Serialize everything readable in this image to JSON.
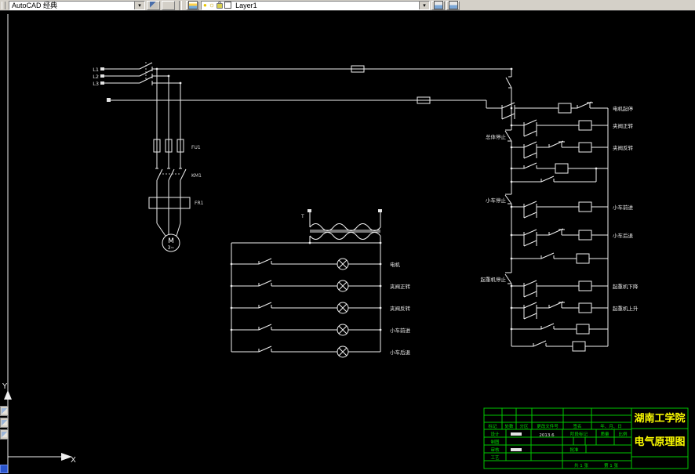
{
  "toolbar": {
    "workspace_label": "AutoCAD 经典",
    "layer_label": "Layer1",
    "dropdown_glyph": "▾",
    "sun_glyph": "☼",
    "bulb_glyph": "●"
  },
  "schematic": {
    "power_labels": [
      "L1",
      "L2",
      "L3"
    ],
    "device_tags": {
      "fuse": "FU1",
      "contactor": "KM1",
      "overload": "FR1",
      "motor": "M",
      "motor_phase": "3~",
      "transformer": "T"
    },
    "ladder_labels": [
      "电机起停",
      "夹阀正转",
      "夹阀反转",
      "小车前进",
      "小车后退",
      "起重机下降",
      "起重机上升"
    ],
    "stop_labels": [
      "总体停止",
      "小车停止",
      "起重机停止"
    ],
    "lamp_labels": [
      "电机",
      "夹阀正转",
      "夹阀反转",
      "小车前进",
      "小车后退"
    ]
  },
  "ucs": {
    "x_label": "X",
    "y_label": "Y"
  },
  "title_block": {
    "school": "湖南工学院",
    "drawing_title": "电气原理图",
    "revision_headers": [
      "标记",
      "处数",
      "分区",
      "更改文件号",
      "签名",
      "年、月、日"
    ],
    "fields": {
      "design": "设计",
      "draft": "制图",
      "review": "审核",
      "process": "工艺",
      "approve": "批准",
      "stage_mark": "阶段标记",
      "weight": "质量",
      "scale": "比例",
      "date": "2013.6",
      "sheet_total": "共 1 张",
      "sheet_no": "第 1 张"
    }
  }
}
